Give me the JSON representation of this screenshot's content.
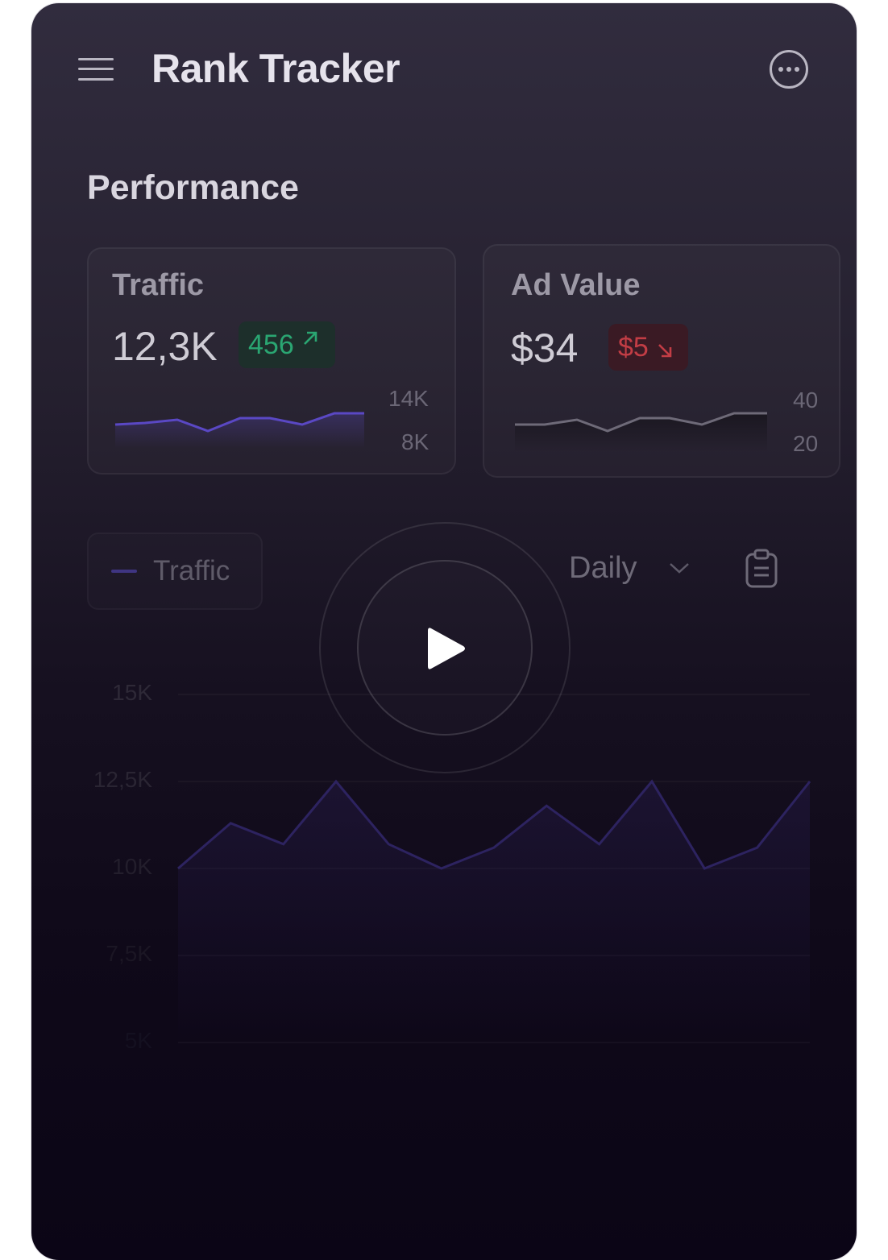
{
  "header": {
    "title": "Rank Tracker",
    "menu_icon": "hamburger-menu-icon",
    "more_icon": "more-options-icon"
  },
  "section": {
    "title": "Performance"
  },
  "cards": [
    {
      "label": "Traffic",
      "value": "12,3K",
      "delta": "456",
      "delta_direction": "up",
      "delta_color": "#2aa672",
      "tick_top": "14K",
      "tick_bottom": "8K"
    },
    {
      "label": "Ad Value",
      "value": "$34",
      "delta": "$5",
      "delta_direction": "down",
      "delta_color": "#c23d45",
      "tick_top": "40",
      "tick_bottom": "20"
    }
  ],
  "chart_controls": {
    "legend_label": "Traffic",
    "period": "Daily",
    "clipboard_icon": "clipboard-icon",
    "chevron_icon": "chevron-down-icon"
  },
  "chart_data": {
    "type": "line",
    "series": [
      {
        "name": "Traffic",
        "values": [
          10000,
          11300,
          10700,
          12500,
          10700,
          10000,
          10600,
          11800,
          10700,
          12500,
          10000,
          10600,
          12500
        ]
      }
    ],
    "y_ticks": [
      "15K",
      "12,5K",
      "10K",
      "7,5K",
      "5K"
    ],
    "ylim": [
      5000,
      15000
    ],
    "grid": true
  },
  "overlay": {
    "play_icon": "play-icon"
  }
}
